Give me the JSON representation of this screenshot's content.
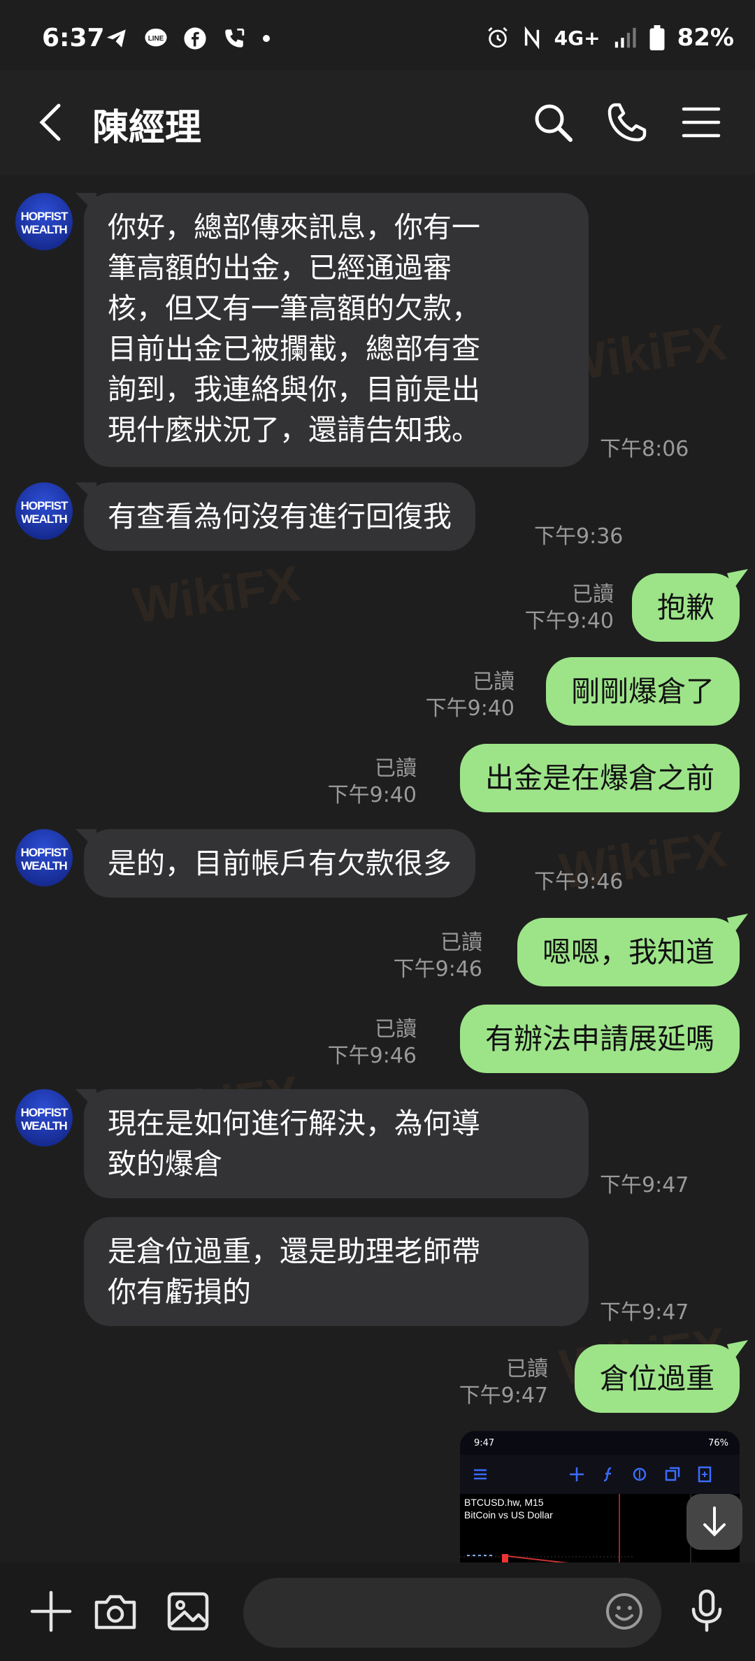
{
  "status_bar": {
    "time": "6:37",
    "network": "4G+",
    "battery": "82%"
  },
  "header": {
    "title": "陳經理"
  },
  "messages": [
    {
      "dir": "in",
      "text": "你好，總部傳來訊息，你有一\n筆高額的出金，已經通過審\n核，但又有一筆高額的欠款，\n目前出金已被攔截，總部有查\n詢到，我連絡與你，目前是出\n現什麼狀況了，還請告知我。",
      "time": "下午8:06"
    },
    {
      "dir": "in",
      "text": "有查看為何沒有進行回復我",
      "time": "下午9:36"
    },
    {
      "dir": "out",
      "text": "抱歉",
      "read": "已讀",
      "time": "下午9:40"
    },
    {
      "dir": "out",
      "text": "剛剛爆倉了",
      "read": "已讀",
      "time": "下午9:40"
    },
    {
      "dir": "out",
      "text": "出金是在爆倉之前",
      "read": "已讀",
      "time": "下午9:40"
    },
    {
      "dir": "in",
      "text": "是的，目前帳戶有欠款很多",
      "time": "下午9:46"
    },
    {
      "dir": "out",
      "text": "嗯嗯，我知道",
      "read": "已讀",
      "time": "下午9:46"
    },
    {
      "dir": "out",
      "text": "有辦法申請展延嗎",
      "read": "已讀",
      "time": "下午9:46"
    },
    {
      "dir": "in",
      "text": "現在是如何進行解決，為何導\n致的爆倉",
      "time": "下午9:47"
    },
    {
      "dir": "in",
      "text": "是倉位過重，還是助理老師帶\n你有虧損的",
      "time": "下午9:47"
    },
    {
      "dir": "out",
      "text": "倉位過重",
      "read": "已讀",
      "time": "下午9:47"
    }
  ],
  "avatar": {
    "line1": "HOPFIST",
    "line2": "WEALTH"
  },
  "screenshot": {
    "time": "9:47",
    "battery": "76%",
    "symbol": "BTCUSD.hw, M15",
    "description": "BitCoin vs US Dollar"
  },
  "composer": {
    "placeholder": ""
  },
  "watermark": "WikiFX",
  "colors": {
    "bubble_out": "#9de489",
    "bubble_in": "#333336",
    "background": "#1e1e1e"
  }
}
